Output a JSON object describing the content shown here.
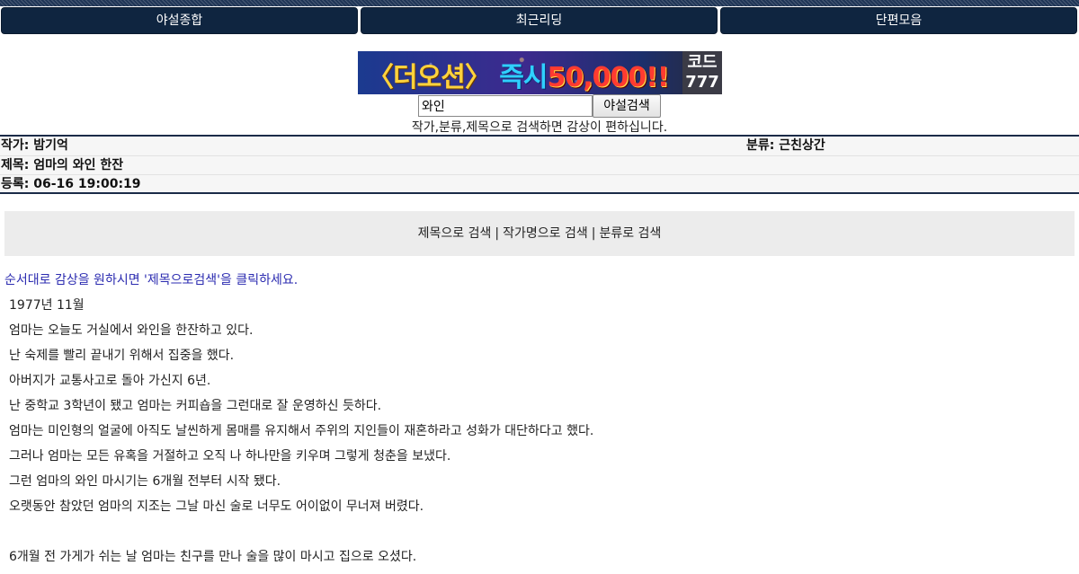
{
  "nav": {
    "items": [
      "야설종합",
      "최근리딩",
      "단편모음"
    ]
  },
  "banner": {
    "bracket_left": "〈",
    "name": "더오션",
    "bracket_right": "〉",
    "now": "즉시",
    "amount": "50,000",
    "bang": "!!",
    "code_label": "코드",
    "code_number": "777"
  },
  "search": {
    "value": "와인",
    "button_label": "야설검색",
    "hint": "작가,분류,제목으로 검색하면 감상이 편하십니다."
  },
  "post": {
    "author": "작가: 밤기억",
    "category": "분류: 근친상간",
    "title": "제목: 엄마의 와인 한잔",
    "date": "등록: 06-16 19:00:19"
  },
  "search_links": {
    "by_title": "제목으로 검색",
    "separator": "|",
    "by_author": "작가명으로 검색",
    "by_category": "분류로 검색"
  },
  "notice": "순서대로 감상을 원하시면 '제목으로검색'을 클릭하세요.",
  "story": {
    "lines": [
      "1977년 11월",
      "엄마는 오늘도 거실에서 와인을 한잔하고 있다.",
      "난 숙제를 빨리 끝내기 위해서 집중을 했다.",
      "아버지가 교통사고로 돌아 가신지 6년.",
      "난 중학교 3학년이 됐고 엄마는 커피숍을 그런대로 잘 운영하신 듯하다.",
      "엄마는 미인형의 얼굴에 아직도 날씬하게 몸매를 유지해서 주위의 지인들이 재혼하라고 성화가 대단하다고 했다.",
      "그러나 엄마는 모든 유혹을 거절하고 오직 나 하나만을 키우며 그렇게 청춘을 보냈다.",
      "그런 엄마의 와인 마시기는 6개월 전부터 시작 됐다.",
      "오랫동안 참았던 엄마의 지조는 그날 마신 술로 너무도 어이없이 무너져 버렸다.",
      "",
      "6개월 전 가게가 쉬는 날 엄마는 친구를 만나 술을 많이 마시고 집으로 오셨다."
    ]
  }
}
